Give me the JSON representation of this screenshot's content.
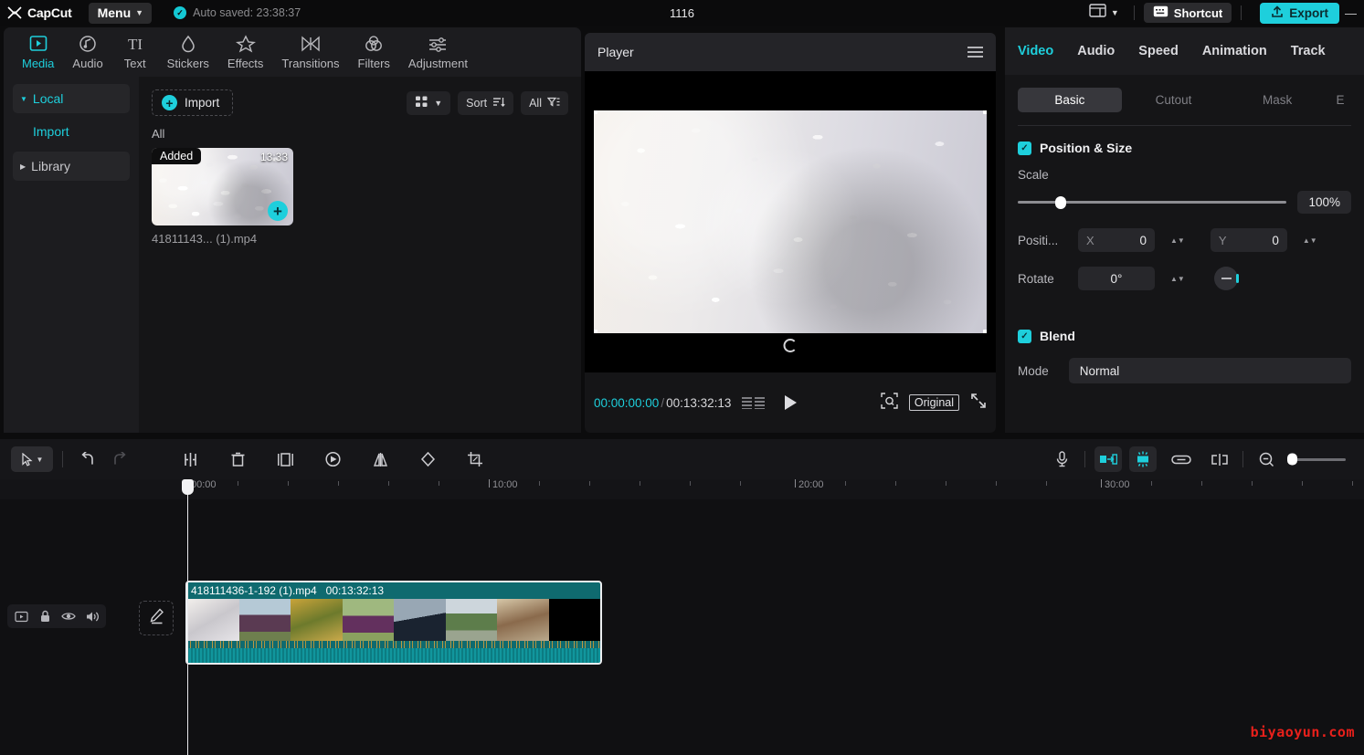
{
  "titlebar": {
    "app_name": "CapCut",
    "menu_label": "Menu",
    "autosave_text": "Auto saved: 23:38:37",
    "project_name": "1116",
    "shortcut_label": "Shortcut",
    "export_label": "Export",
    "minimize_label": "—",
    "icons": {
      "logo": "capcut-logo-icon",
      "menu_caret": "chevron-down-icon",
      "autosave_check": "check-circle-icon",
      "layout": "layout-icon",
      "layout_caret": "chevron-down-icon",
      "shortcut": "keyboard-icon",
      "export": "upload-icon"
    }
  },
  "nav": {
    "items": [
      {
        "label": "Media",
        "icon": "media-icon",
        "active": true
      },
      {
        "label": "Audio",
        "icon": "audio-note-icon",
        "active": false
      },
      {
        "label": "Text",
        "icon": "text-icon",
        "active": false
      },
      {
        "label": "Stickers",
        "icon": "sticker-drop-icon",
        "active": false
      },
      {
        "label": "Effects",
        "icon": "effects-star-icon",
        "active": false
      },
      {
        "label": "Transitions",
        "icon": "transitions-icon",
        "active": false
      },
      {
        "label": "Filters",
        "icon": "filters-circles-icon",
        "active": false
      },
      {
        "label": "Adjustment",
        "icon": "adjustment-sliders-icon",
        "active": false
      }
    ]
  },
  "sidebar": {
    "items": [
      {
        "label": "Local",
        "type": "group",
        "expanded": true,
        "highlight": true
      },
      {
        "label": "Import",
        "type": "sub",
        "highlight": true
      },
      {
        "label": "Library",
        "type": "group",
        "expanded": false,
        "highlight": false
      }
    ]
  },
  "media": {
    "import_label": "Import",
    "view_mode_icon": "grid-view-icon",
    "sort_label": "Sort",
    "sort_icon": "sort-icon",
    "filter_label": "All",
    "filter_icon": "filter-icon",
    "section_label": "All",
    "items": [
      {
        "badge": "Added",
        "duration": "13:33",
        "name": "41811143... (1).mp4",
        "add_icon": "plus-icon"
      }
    ]
  },
  "player": {
    "title": "Player",
    "menu_icon": "hamburger-icon",
    "current_time": "00:00:00:00",
    "time_separator": "/",
    "total_time": "00:13:32:13",
    "frame_icon": "frames-icon",
    "play_icon": "play-icon",
    "zoom_fit_icon": "fit-zoom-icon",
    "quality_label": "Original",
    "fullscreen_icon": "fullscreen-icon"
  },
  "props": {
    "tabs": [
      {
        "label": "Video",
        "active": true
      },
      {
        "label": "Audio",
        "active": false
      },
      {
        "label": "Speed",
        "active": false
      },
      {
        "label": "Animation",
        "active": false
      },
      {
        "label": "Track",
        "active": false
      }
    ],
    "segments": [
      {
        "label": "Basic",
        "active": true
      },
      {
        "label": "Cutout",
        "active": false
      },
      {
        "label": "Mask",
        "active": false
      },
      {
        "label": "E",
        "active": false
      }
    ],
    "position_size": {
      "title": "Position & Size",
      "enabled": true,
      "scale_label": "Scale",
      "scale_value": "100%",
      "scale_percent": 16,
      "position_label": "Positi...",
      "x_axis": "X",
      "x_value": "0",
      "y_axis": "Y",
      "y_value": "0",
      "rotate_label": "Rotate",
      "rotate_value": "0°"
    },
    "blend": {
      "title": "Blend",
      "enabled": true,
      "mode_label": "Mode",
      "mode_value": "Normal"
    }
  },
  "timeline": {
    "tools_left": [
      {
        "name": "select-tool",
        "icon": "cursor-icon",
        "boxed": true,
        "dim": false
      },
      {
        "name": "undo",
        "icon": "undo-icon",
        "boxed": false,
        "dim": false
      },
      {
        "name": "redo",
        "icon": "redo-icon",
        "boxed": false,
        "dim": true
      },
      {
        "name": "split",
        "icon": "split-icon",
        "boxed": false,
        "dim": false
      },
      {
        "name": "delete",
        "icon": "trash-icon",
        "boxed": false,
        "dim": false
      },
      {
        "name": "freeze",
        "icon": "freeze-frame-icon",
        "boxed": false,
        "dim": false
      },
      {
        "name": "reverse",
        "icon": "reverse-icon",
        "boxed": false,
        "dim": false
      },
      {
        "name": "mirror",
        "icon": "mirror-icon",
        "boxed": false,
        "dim": false
      },
      {
        "name": "rotate",
        "icon": "rotate-icon",
        "boxed": false,
        "dim": false
      },
      {
        "name": "crop",
        "icon": "crop-icon",
        "boxed": false,
        "dim": false
      }
    ],
    "tools_right": [
      {
        "name": "record-voiceover",
        "icon": "microphone-icon",
        "on": false
      },
      {
        "name": "auto-fit",
        "icon": "fit-clip-icon",
        "on": true
      },
      {
        "name": "auto-cut",
        "icon": "auto-cut-icon",
        "on": true
      },
      {
        "name": "link",
        "icon": "link-icon",
        "on": false
      },
      {
        "name": "mixer",
        "icon": "mixer-icon",
        "on": false
      },
      {
        "name": "zoom-out",
        "icon": "zoom-out-icon",
        "on": false
      }
    ],
    "ruler_labels": [
      "00:00",
      "10:00",
      "20:00",
      "30:00"
    ],
    "track_controls": [
      {
        "name": "track-video",
        "icon": "video-track-icon"
      },
      {
        "name": "track-lock",
        "icon": "lock-icon"
      },
      {
        "name": "track-visibility",
        "icon": "eye-icon"
      },
      {
        "name": "track-volume",
        "icon": "volume-icon"
      }
    ],
    "edit_button_icon": "pencil-icon",
    "clip": {
      "name": "418111436-1-192 (1).mp4",
      "duration": "00:13:32:13"
    }
  },
  "watermark": "biyaoyun.com",
  "colors": {
    "accent": "#1ecfdc",
    "clip": "#0f6a6f",
    "watermark": "#e8201b",
    "panel_bg": "#151517",
    "app_bg": "#0c0c0d"
  }
}
